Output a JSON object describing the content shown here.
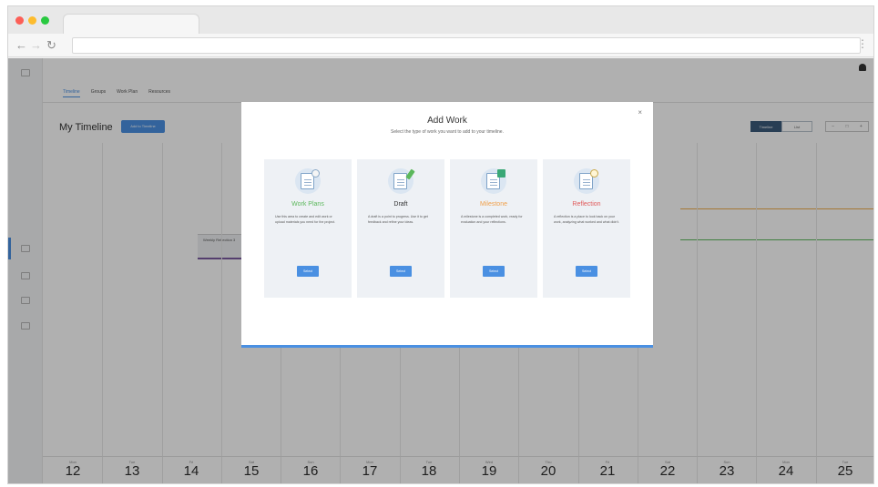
{
  "browser": {
    "address": ""
  },
  "app": {
    "tabs": [
      "Timeline",
      "Groups",
      "Work Plan",
      "Resources"
    ],
    "page_title": "My Timeline",
    "add_button": "Add to Timeline",
    "view_toggle": [
      "Timeline",
      "List"
    ],
    "event_label": "Weekly Reflection 3"
  },
  "dates": [
    {
      "dow": "Mon",
      "num": "12"
    },
    {
      "dow": "Tue",
      "num": "13"
    },
    {
      "dow": "Fri",
      "num": "14"
    },
    {
      "dow": "Sat",
      "num": "15"
    },
    {
      "dow": "Sun",
      "num": "16"
    },
    {
      "dow": "Mon",
      "num": "17"
    },
    {
      "dow": "Tue",
      "num": "18"
    },
    {
      "dow": "Wed",
      "num": "19"
    },
    {
      "dow": "Thu",
      "num": "20"
    },
    {
      "dow": "Fri",
      "num": "21"
    },
    {
      "dow": "Sat",
      "num": "22"
    },
    {
      "dow": "Sun",
      "num": "23"
    },
    {
      "dow": "Mon",
      "num": "24"
    },
    {
      "dow": "Tue",
      "num": "25"
    }
  ],
  "modal": {
    "title": "Add Work",
    "subtitle": "Select the type of work you want to add to your timeline.",
    "close": "×",
    "cards": [
      {
        "title": "Work Plans",
        "color": "#5cb85c",
        "icon": "work-plan-icon",
        "description": "Use this area to create and edit work or upload materials you need for the project.",
        "button": "Select"
      },
      {
        "title": "Draft",
        "color": "#333333",
        "icon": "draft-icon",
        "description": "A draft is a point to progress. Use it to get feedback and refine your ideas.",
        "button": "Select"
      },
      {
        "title": "Milestone",
        "color": "#f0a04b",
        "icon": "milestone-icon",
        "description": "A milestone is a completed work, ready for evaluation and your reflections.",
        "button": "Select"
      },
      {
        "title": "Reflection",
        "color": "#e05a5a",
        "icon": "reflection-icon",
        "description": "A reflection is a place to look back on your work, analyzing what worked and what didn't.",
        "button": "Select"
      }
    ]
  },
  "colors": {
    "accent": "#4a90e2",
    "overlay": "rgba(0,0,0,0.31)"
  }
}
